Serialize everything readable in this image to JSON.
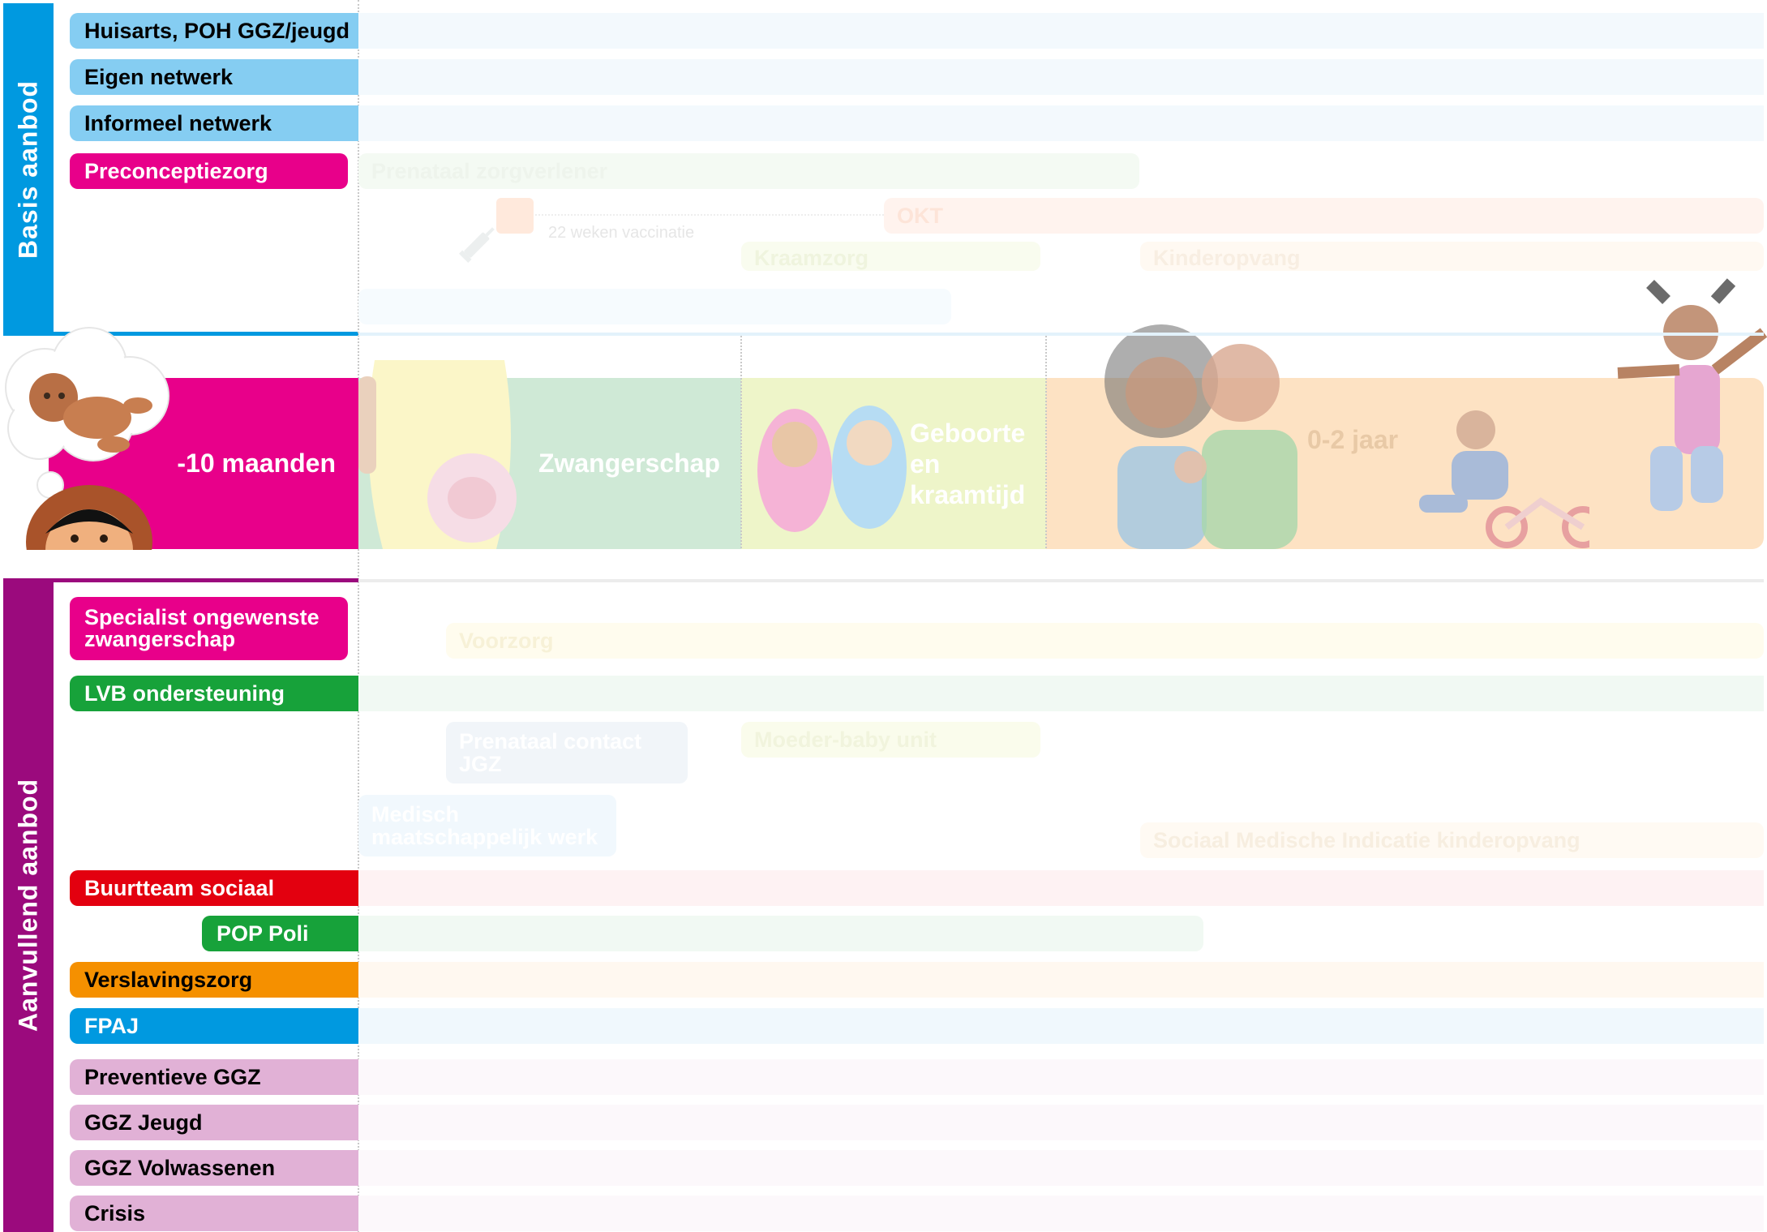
{
  "sections": {
    "basis": "Basis aanbod",
    "aanvullend": "Aanvullend aanbod"
  },
  "basis_rows": {
    "huisarts": "Huisarts, POH GGZ/jeugd",
    "eigen": "Eigen netwerk",
    "informeel": "Informeel netwerk",
    "preconceptie": "Preconceptiezorg"
  },
  "basis_faded": {
    "prenataal": "Prenataal zorgverlener",
    "okt": "OKT",
    "vaccinatie": "22 weken vaccinatie",
    "kraamzorg": "Kraamzorg",
    "kinderopvang": "Kinderopvang"
  },
  "timeline": {
    "pre": "-10 maanden",
    "zwangerschap": "Zwangerschap",
    "geboorte": "Geboorte en kraamtijd",
    "jaar": "0-2 jaar"
  },
  "aanvullend_rows": {
    "specialist": "Specialist ongewenste zwangerschap",
    "lvb": "LVB ondersteuning",
    "buurtteam": "Buurtteam sociaal",
    "pop": "POP Poli",
    "verslaving": "Verslavingszorg",
    "fpaj": "FPAJ",
    "preventieve": "Preventieve GGZ",
    "ggz_jeugd": "GGZ Jeugd",
    "ggz_volw": "GGZ Volwassenen",
    "crisis": "Crisis"
  },
  "aanvullend_faded": {
    "voorzorg": "Voorzorg",
    "prenataal_jgz": "Prenataal contact JGZ",
    "moeder_baby": "Moeder-baby unit",
    "mmw": "Medisch maatschappelijk werk",
    "smi": "Sociaal Medische Indicatie kinderopvang"
  },
  "colors": {
    "basis_blue": "#0099e0",
    "light_blue": "#85cdf2",
    "magenta": "#e8008a",
    "purple": "#9b0a7d",
    "green": "#17a23a",
    "red": "#e3000f",
    "orange": "#f59000",
    "pink_light": "#e1b1d6",
    "zwanger_green": "#cfe9d6",
    "geboorte_yellow": "#eef5c9",
    "jaar_orange": "#fde2c3"
  },
  "icons": [
    "thought-bubble-icon",
    "baby-icon",
    "girl-face-icon",
    "pregnant-woman-icon",
    "newborn-twins-icon",
    "family-icon",
    "toddler-bike-icon",
    "jumping-girl-icon",
    "syringe-icon"
  ]
}
